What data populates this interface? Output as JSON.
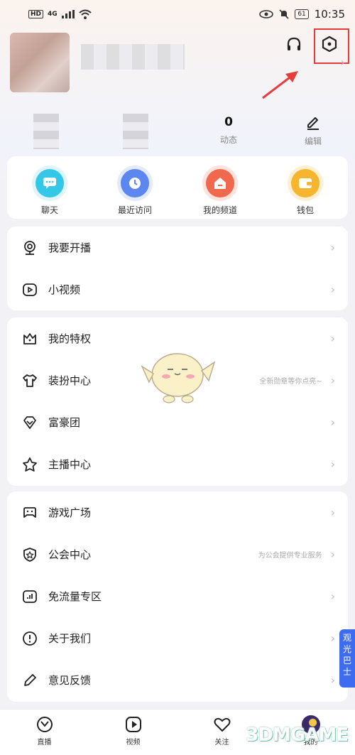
{
  "status": {
    "badge": "HD",
    "network": "4G",
    "battery": "61",
    "time": "10:35"
  },
  "stats": [
    {
      "value": "0",
      "label": "动态"
    },
    {
      "label": "编辑"
    }
  ],
  "quick": [
    {
      "label": "聊天",
      "icon": "chat-icon",
      "color": "#35c7e8"
    },
    {
      "label": "最近访问",
      "icon": "recent-visit-icon",
      "color": "#5c87f0"
    },
    {
      "label": "我的频道",
      "icon": "channel-icon",
      "color": "#f0694f"
    },
    {
      "label": "钱包",
      "icon": "wallet-icon",
      "color": "#f6b52c"
    }
  ],
  "group1": [
    {
      "label": "我要开播",
      "icon": "broadcast-icon"
    },
    {
      "label": "小视频",
      "icon": "video-icon"
    }
  ],
  "group2": [
    {
      "label": "我的特权",
      "icon": "crown-icon"
    },
    {
      "label": "装扮中心",
      "icon": "tshirt-icon",
      "hint": "全新勋章等你点亮~"
    },
    {
      "label": "富豪团",
      "icon": "diamond-icon"
    },
    {
      "label": "主播中心",
      "icon": "star-icon"
    }
  ],
  "group3": [
    {
      "label": "游戏广场",
      "icon": "gamepad-icon"
    },
    {
      "label": "公会中心",
      "icon": "guild-icon",
      "hint": "为公会提供专业服务"
    },
    {
      "label": "免流量专区",
      "icon": "data-free-icon"
    },
    {
      "label": "关于我们",
      "icon": "info-icon"
    },
    {
      "label": "意见反馈",
      "icon": "pencil-icon"
    }
  ],
  "side_tag": "观光巴士",
  "nav": [
    {
      "label": "直播",
      "icon": "live-icon"
    },
    {
      "label": "视频",
      "icon": "play-icon"
    },
    {
      "label": "关注",
      "icon": "heart-icon"
    },
    {
      "label": "我的",
      "icon": "profile-avatar-icon"
    }
  ],
  "watermark": "3DMGAME"
}
